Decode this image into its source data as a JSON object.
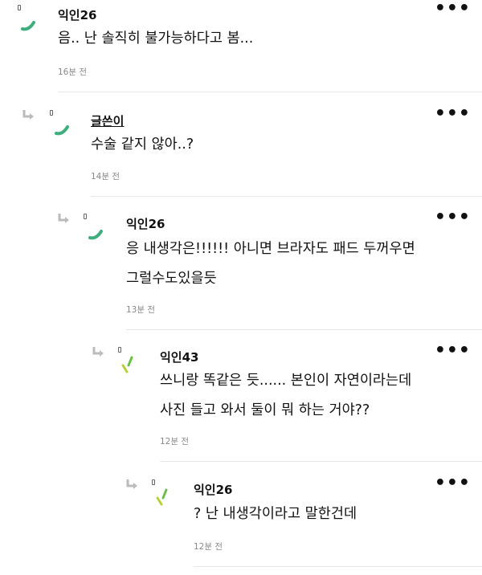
{
  "comments": [
    {
      "author": "익인26",
      "body": [
        "음.. 난 솔직히 불가능하다고 봄..."
      ],
      "time": "16분 전"
    },
    {
      "author": "글쓴이",
      "body": [
        "수술 같지 않아..?"
      ],
      "time": "14분 전"
    },
    {
      "author": "익인26",
      "body": [
        "응 내생각은!!!!!! 아니면 브라자도 패드 두꺼우면",
        "그럴수도있을듯"
      ],
      "time": "13분 전"
    },
    {
      "author": "익인43",
      "body": [
        "쓰니랑 똑같은 듯...... 본인이 자연이라는데",
        "사진 들고 와서 둘이 뭐 하는 거야??"
      ],
      "time": "12분 전"
    },
    {
      "author": "익인26",
      "body": [
        "? 난 내생각이라고 말한건데"
      ],
      "time": "12분 전"
    }
  ],
  "more_label": "•••",
  "icons": {
    "reply": "reply-arrow-icon",
    "badge": "anon-badge-icon",
    "avatar_teal": "#3fae7f",
    "avatar_lime": "#b8cf3a",
    "avatar_green": "#6cbf4a"
  }
}
